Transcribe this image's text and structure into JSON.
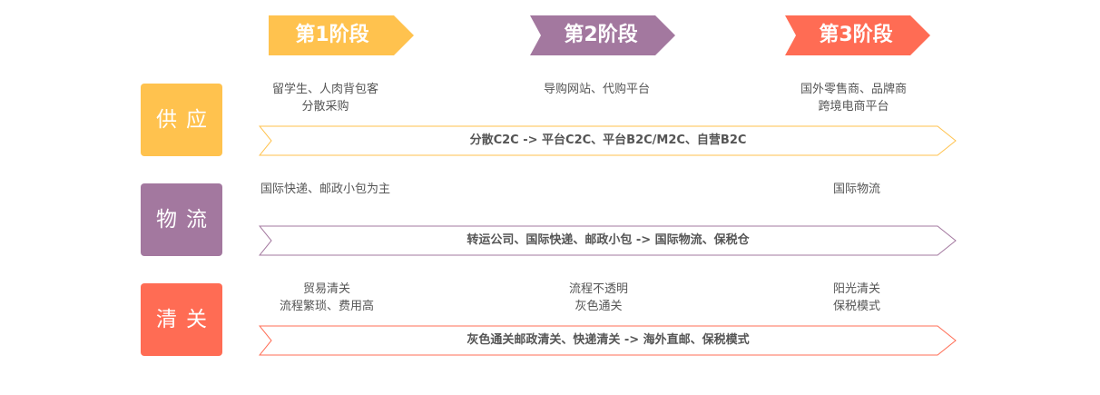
{
  "colors": {
    "supply": "#ffc24e",
    "logistics": "#a3789f",
    "customs": "#ff6c54"
  },
  "stages": [
    {
      "label": "第1阶段",
      "color": "#ffc24e"
    },
    {
      "label": "第2阶段",
      "color": "#a3789f"
    },
    {
      "label": "第3阶段",
      "color": "#ff6c54"
    }
  ],
  "rows": [
    {
      "category": "供应",
      "color": "#ffc24e",
      "stage_texts": [
        [
          "留学生、人肉背包客",
          "分散采购"
        ],
        [
          "导购网站、代购平台"
        ],
        [
          "国外零售商、品牌商",
          "跨境电商平台"
        ]
      ],
      "arrow_label": "分散C2C -> 平台C2C、平台B2C/M2C、自营B2C"
    },
    {
      "category": "物流",
      "color": "#a3789f",
      "stage_texts": [
        [
          "国际快递、邮政小包为主"
        ],
        [],
        [
          "国际物流"
        ]
      ],
      "arrow_label": "转运公司、国际快递、邮政小包 -> 国际物流、保税仓"
    },
    {
      "category": "清关",
      "color": "#ff6c54",
      "stage_texts": [
        [
          "贸易清关",
          "流程繁琐、费用高"
        ],
        [
          "流程不透明",
          "灰色通关"
        ],
        [
          "阳光清关",
          "保税模式"
        ]
      ],
      "arrow_label": "灰色通关邮政清关、快递清关 -> 海外直邮、保税模式"
    }
  ]
}
